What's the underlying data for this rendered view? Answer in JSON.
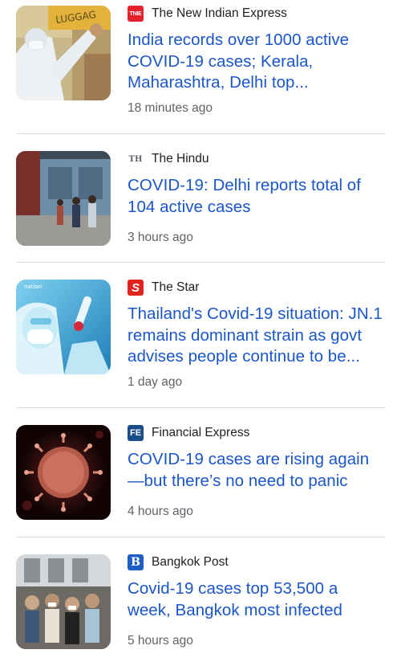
{
  "articles": [
    {
      "source": "The New Indian Express",
      "logo_text": "TNIE",
      "logo_color": "#e4222b",
      "headline": "India records over 1000 active COVID-19 cases; Kerala, Maharashtra, Delhi top...",
      "time": "18 minutes ago"
    },
    {
      "source": "The Hindu",
      "logo_text": "TH",
      "logo_color": "#5f6368",
      "headline": "COVID-19: Delhi reports total of 104 active cases",
      "time": "3 hours ago"
    },
    {
      "source": "The Star",
      "logo_text": "S",
      "logo_color": "#e0231c",
      "thumb_badge": "nation",
      "headline": "Thailand's Covid-19 situation: JN.1 remains dominant strain as govt advises people continue to be...",
      "time": "1 day ago"
    },
    {
      "source": "Financial Express",
      "logo_text": "FE",
      "logo_color": "#1b4d89",
      "headline": "COVID-19 cases are rising again—but there’s no need to panic",
      "time": "4 hours ago"
    },
    {
      "source": "Bangkok Post",
      "logo_text": "B",
      "logo_color": "#1d5fc4",
      "headline": "Covid-19 cases top 53,500 a week, Bangkok most infected",
      "time": "5 hours ago"
    }
  ]
}
